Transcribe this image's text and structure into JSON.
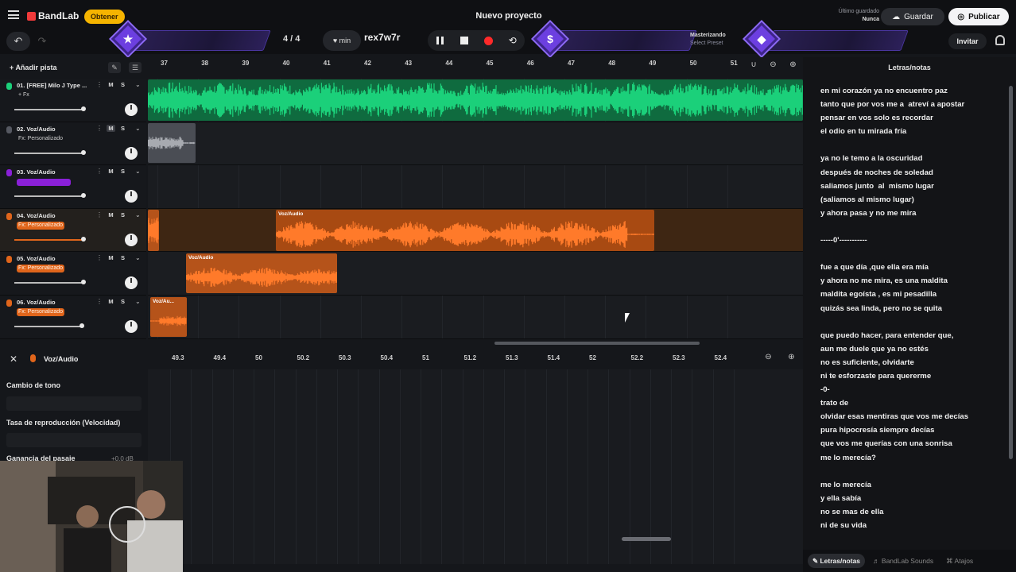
{
  "app": {
    "logo": "BandLab",
    "obtener": "Obtener",
    "project_title": "Nuevo proyecto",
    "saved_label": "Último guardado",
    "saved_value": "Nunca",
    "save_button": "Guardar",
    "publish_button": "Publicar",
    "invite_button": "Invitar"
  },
  "transport": {
    "time_signature": "4 / 4",
    "tempo_unit": "min",
    "key": "rex7w7r",
    "mastering_label": "Masterizando",
    "mastering_sub": "Select Preset"
  },
  "tracks_toolbar": {
    "add_track": "Añadir pista"
  },
  "tracks": [
    {
      "name": "01. [FREE] Milo J Type ...",
      "fx": "+ Fx",
      "fx_style": "plain",
      "color": "#1bd07a",
      "mute": "M",
      "solo": "S",
      "volume": 0.95,
      "muted": false
    },
    {
      "name": "02. Voz/Audio",
      "fx": "Fx: Personalizado",
      "fx_style": "plain",
      "color": "#555861",
      "mute": "M",
      "solo": "S",
      "volume": 0.95,
      "muted": true
    },
    {
      "name": "03. Voz/Audio",
      "fx": "",
      "fx_style": "purple",
      "color": "#8a20d8",
      "mute": "M",
      "solo": "S",
      "volume": 0.95,
      "muted": false
    },
    {
      "name": "04. Voz/Audio",
      "fx": "Fx: Personalizado",
      "fx_style": "orange",
      "color": "#e0651b",
      "mute": "M",
      "solo": "S",
      "volume": 0.95,
      "muted": false
    },
    {
      "name": "05. Voz/Audio",
      "fx": "Fx: Personalizado",
      "fx_style": "orange",
      "color": "#e0651b",
      "mute": "M",
      "solo": "S",
      "volume": 0.95,
      "muted": false
    },
    {
      "name": "06. Voz/Audio",
      "fx": "Fx: Personalizado",
      "fx_style": "orange",
      "color": "#e0651b",
      "mute": "M",
      "solo": "S",
      "volume": 0.95,
      "muted": false
    }
  ],
  "ruler_marks": [
    "37",
    "38",
    "39",
    "40",
    "41",
    "42",
    "43",
    "44",
    "45",
    "46",
    "47",
    "48",
    "49",
    "50",
    "51"
  ],
  "clips": {
    "track4": "Voz/Audio",
    "track5": "Voz/Audio",
    "track6": "Voz/Au..."
  },
  "editor": {
    "title": "Voz/Audio",
    "pitch_label": "Cambio de tono",
    "rate_label": "Tasa de reproducción (Velocidad)",
    "gain_label": "Ganancia del pasaje",
    "gain_value": "+0.0 dB",
    "ruler_marks": [
      "49.3",
      "49.4",
      "50",
      "50.2",
      "50.3",
      "50.4",
      "51",
      "51.2",
      "51.3",
      "51.4",
      "52",
      "52.2",
      "52.3",
      "52.4"
    ]
  },
  "lyrics": {
    "title": "Letras/notas",
    "text": "en mi corazón ya no encuentro paz\ntanto que por vos me a  atreví a apostar\npensar en vos solo es recordar\nel odio en tu mirada fría\n\nya no le temo a la oscuridad\ndespués de noches de soledad\nsaliamos junto  al  mismo lugar\n(saliamos al mismo lugar)\ny ahora pasa y no me mira\n\n-----0'-----------\n\nfue a que día ,que ella era mía\ny ahora no me mira, es una maldita\nmaldita egoísta , es mi pesadilla\nquizás sea linda, pero no se quita\n\nque puedo hacer, para entender que,\naun me duele que ya no estés\nno es suficiente, olvidarte\nni te esforzaste para quererme\n-0-\ntrato de\nolvidar esas mentiras que vos me decías\npura hipocresía siempre decías\nque vos me querías con una sonrisa\nme lo merecía?\n\nme lo merecía\ny ella sabía\nno se mas de ella\nni de su vida"
  },
  "bottom_tabs": [
    "Letras/notas",
    "BandLab Sounds",
    "Atajos"
  ],
  "colors": {
    "accent_green": "#1bd07a",
    "accent_orange": "#e0651b",
    "accent_purple": "#6c3fe0",
    "record": "#ff2a2a"
  }
}
